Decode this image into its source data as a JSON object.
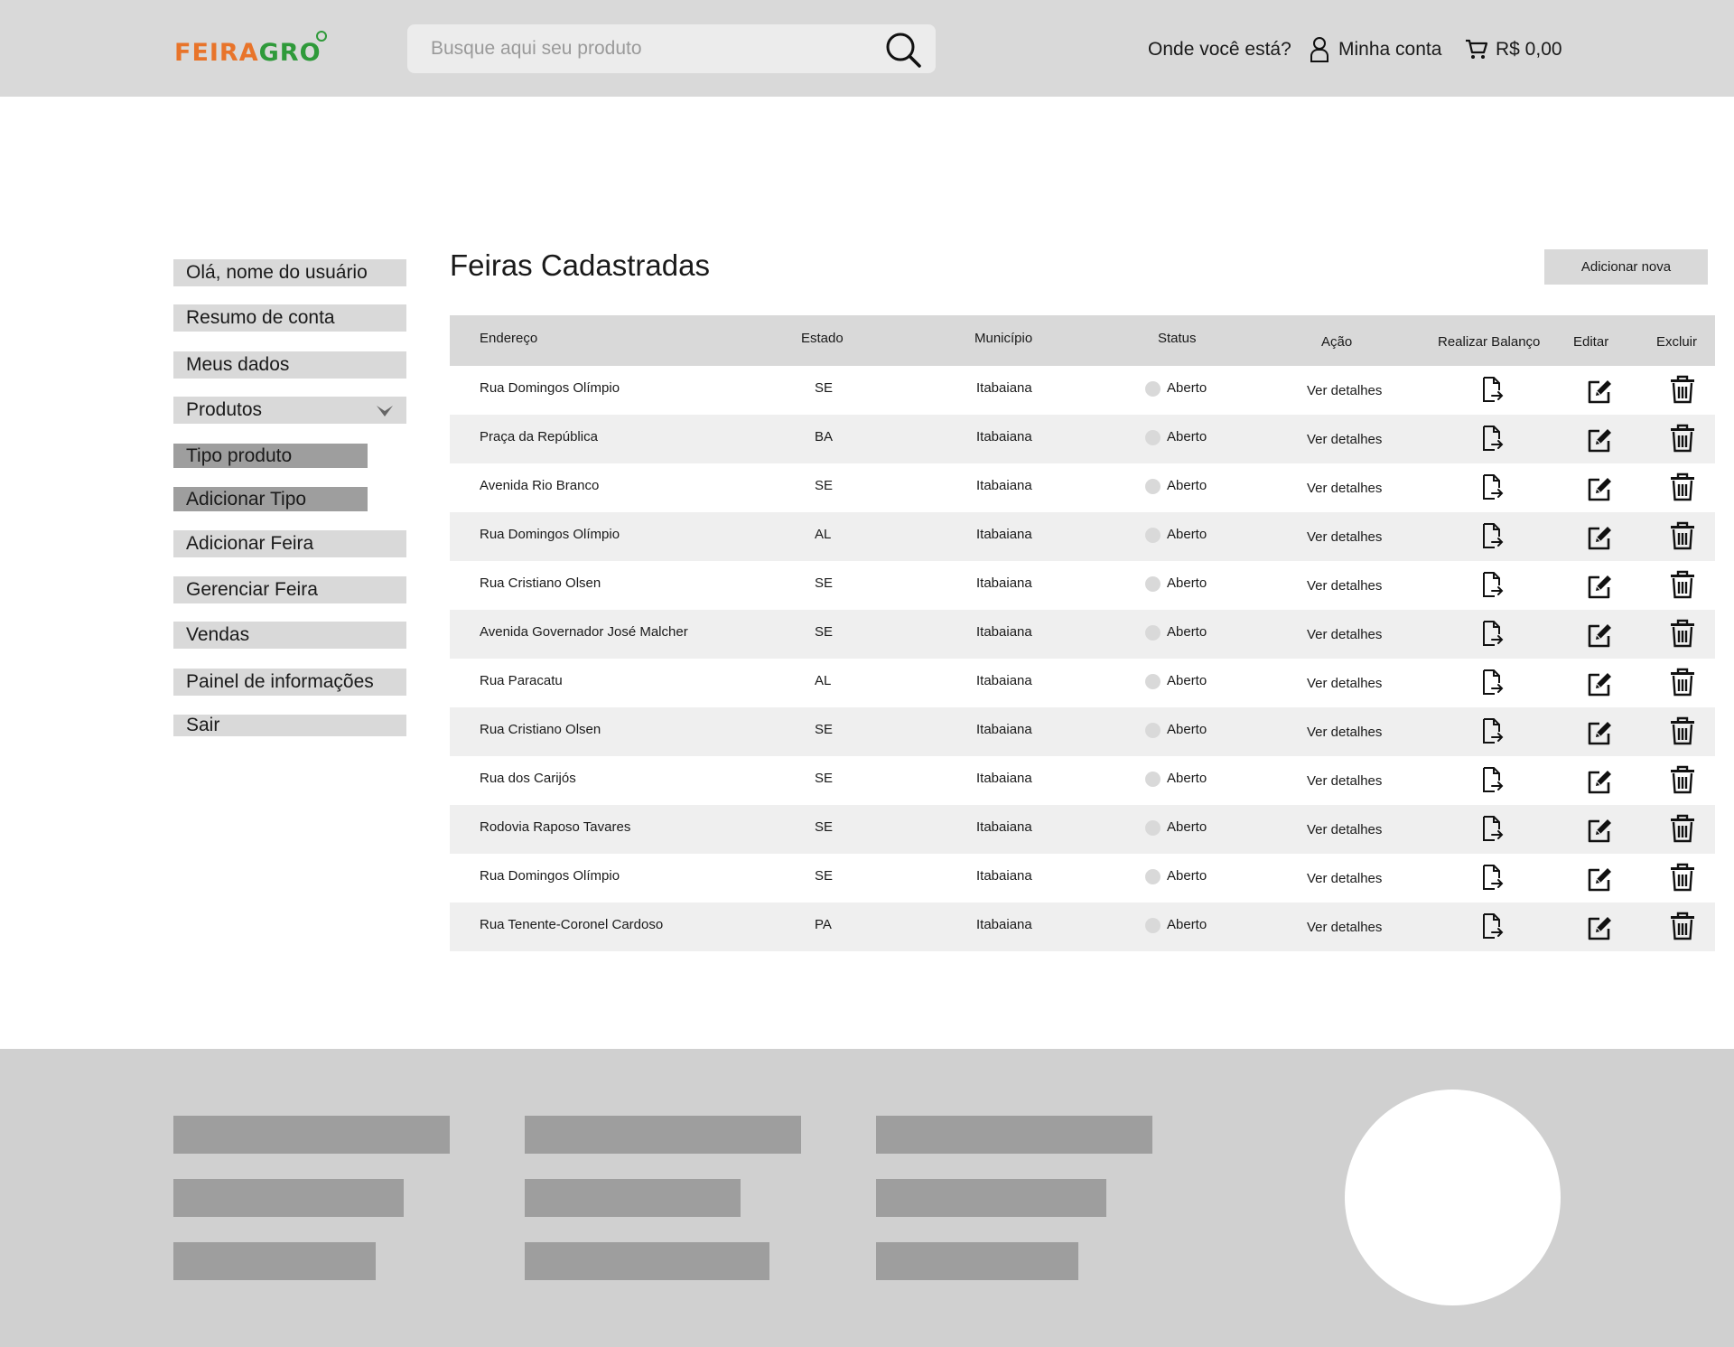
{
  "header": {
    "logo_part1": "FEIRA",
    "logo_part2": "GRO",
    "search_placeholder": "Busque aqui seu produto",
    "location_label": "Onde você está?",
    "account_label": "Minha conta",
    "cart_total": "R$ 0,00"
  },
  "sidebar": {
    "greeting": "Olá, nome do usuário",
    "items": [
      {
        "label": "Resumo de conta"
      },
      {
        "label": "Meus dados"
      },
      {
        "label": "Produtos"
      },
      {
        "label": "Tipo produto"
      },
      {
        "label": "Adicionar Tipo"
      },
      {
        "label": "Adicionar Feira"
      },
      {
        "label": "Gerenciar Feira"
      },
      {
        "label": "Vendas"
      },
      {
        "label": "Painel de informações"
      },
      {
        "label": "Sair"
      }
    ]
  },
  "main": {
    "title": "Feiras Cadastradas",
    "add_button": "Adicionar nova",
    "columns": [
      "Endereço",
      "Estado",
      "Município",
      "Status",
      "Ação",
      "Realizar Balanço",
      "Editar",
      "Excluir"
    ],
    "rows": [
      {
        "address": "Rua Domingos Olímpio",
        "state": "SE",
        "city": "Itabaiana",
        "status": "Aberto",
        "action": "Ver detalhes"
      },
      {
        "address": "Praça da República",
        "state": "BA",
        "city": "Itabaiana",
        "status": "Aberto",
        "action": "Ver detalhes"
      },
      {
        "address": "Avenida Rio Branco",
        "state": "SE",
        "city": "Itabaiana",
        "status": "Aberto",
        "action": "Ver detalhes"
      },
      {
        "address": "Rua Domingos Olímpio",
        "state": "AL",
        "city": "Itabaiana",
        "status": "Aberto",
        "action": "Ver detalhes"
      },
      {
        "address": "Rua Cristiano Olsen",
        "state": "SE",
        "city": "Itabaiana",
        "status": "Aberto",
        "action": "Ver detalhes"
      },
      {
        "address": "Avenida Governador José Malcher",
        "state": "SE",
        "city": "Itabaiana",
        "status": "Aberto",
        "action": "Ver detalhes"
      },
      {
        "address": "Rua Paracatu",
        "state": "AL",
        "city": "Itabaiana",
        "status": "Aberto",
        "action": "Ver detalhes"
      },
      {
        "address": "Rua Cristiano Olsen",
        "state": "SE",
        "city": "Itabaiana",
        "status": "Aberto",
        "action": "Ver detalhes"
      },
      {
        "address": "Rua dos Carijós",
        "state": "SE",
        "city": "Itabaiana",
        "status": "Aberto",
        "action": "Ver detalhes"
      },
      {
        "address": "Rodovia Raposo Tavares",
        "state": "SE",
        "city": "Itabaiana",
        "status": "Aberto",
        "action": "Ver detalhes"
      },
      {
        "address": "Rua Domingos Olímpio",
        "state": "SE",
        "city": "Itabaiana",
        "status": "Aberto",
        "action": "Ver detalhes"
      },
      {
        "address": "Rua Tenente-Coronel Cardoso",
        "state": "PA",
        "city": "Itabaiana",
        "status": "Aberto",
        "action": "Ver detalhes"
      }
    ]
  },
  "icons": {
    "search": "search-icon",
    "account": "user-icon",
    "cart": "cart-icon",
    "expand": "chevron-down-icon",
    "balance": "file-export-icon",
    "edit": "edit-icon",
    "delete": "trash-icon",
    "status": "status-dot-icon"
  },
  "colors": {
    "logo_orange": "#e8742a",
    "logo_green": "#2f9a3a",
    "header_bg": "#d9d9d9",
    "footer_bg": "#d0d0d0",
    "row_alt_bg": "#efefef"
  }
}
